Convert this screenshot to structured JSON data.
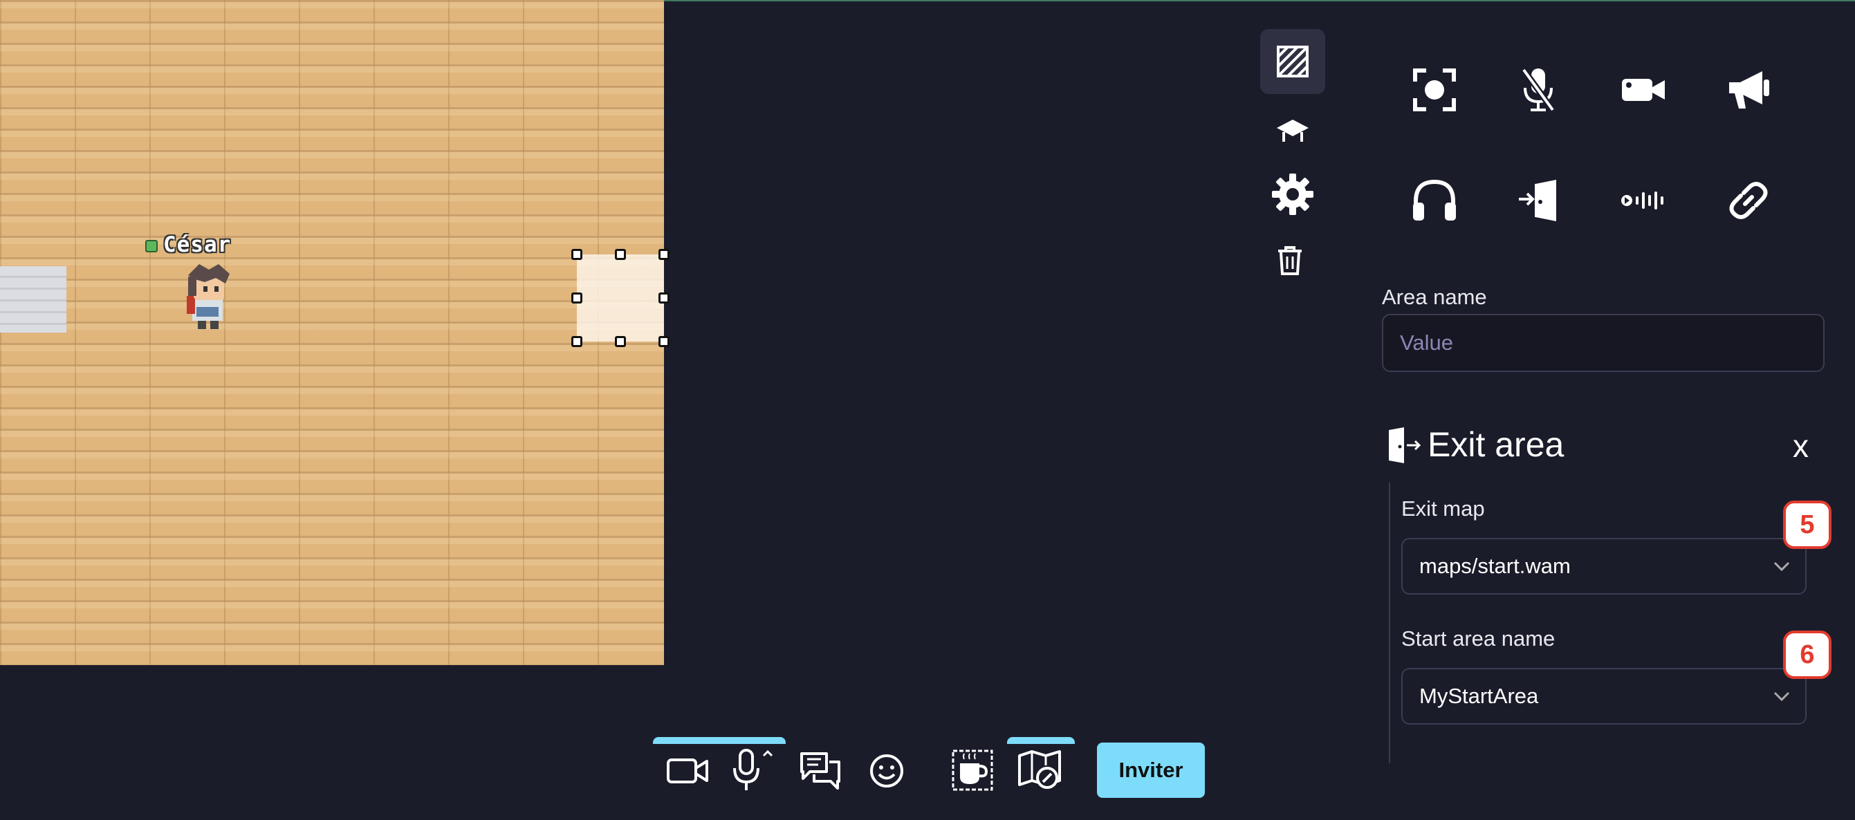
{
  "map": {
    "player_name": "César"
  },
  "right_panel": {
    "area_name_label": "Area name",
    "area_name_value": "",
    "area_name_placeholder": "Value",
    "exit_section": {
      "title": "Exit area",
      "close_label": "x",
      "exit_map_label": "Exit map",
      "exit_map_value": "maps/start.wam",
      "start_area_label": "Start area name",
      "start_area_value": "MyStartArea"
    },
    "badges": [
      "5",
      "6"
    ],
    "property_icons": [
      "focus-icon",
      "microphone-off-icon",
      "video-camera-icon",
      "megaphone-icon",
      "headphones-icon",
      "exit-door-icon",
      "audio-wave-icon",
      "link-icon"
    ],
    "toolbar_icons": [
      "area-hatch-icon",
      "entity-icon",
      "settings-gear-icon",
      "trash-icon"
    ]
  },
  "bottom_bar": {
    "invite_label": "Inviter",
    "icons": [
      "camera-icon",
      "microphone-icon",
      "chat-icon",
      "emoji-icon",
      "coffee-icon",
      "map-editor-icon"
    ]
  },
  "colors": {
    "background": "#1b1c2a",
    "accent": "#7ddcf9",
    "badge_red": "#e23b2e",
    "floor": "#e0b67d"
  }
}
